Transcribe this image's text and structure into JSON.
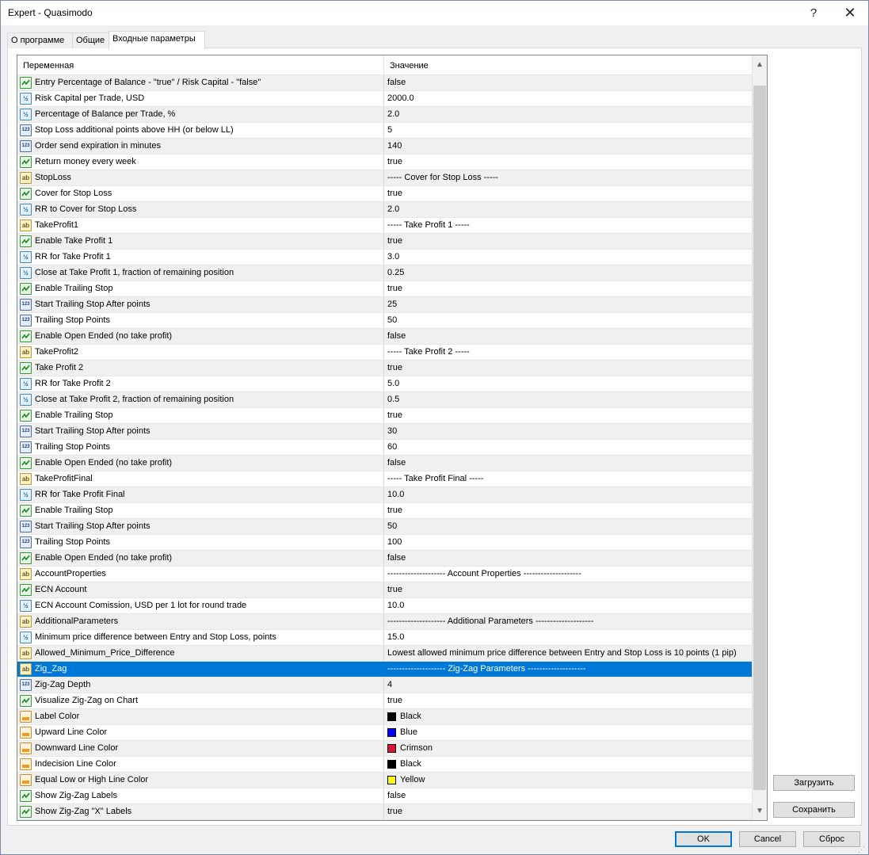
{
  "window": {
    "title": "Expert - Quasimodo",
    "help_label": "?",
    "close_label": "✕"
  },
  "tabs": [
    {
      "label": "О программе"
    },
    {
      "label": "Общие"
    },
    {
      "label": "Входные параметры"
    }
  ],
  "grid": {
    "col_variable": "Переменная",
    "col_value": "Значение",
    "rows": [
      {
        "icon": "bool",
        "name": "Entry Percentage of Balance - \"true\" / Risk Capital - \"false\"",
        "value": "false"
      },
      {
        "icon": "dbl",
        "name": "Risk Capital per Trade, USD",
        "value": "2000.0"
      },
      {
        "icon": "dbl",
        "name": "Percentage of Balance per Trade, %",
        "value": "2.0"
      },
      {
        "icon": "int",
        "name": "Stop Loss additional points above HH (or below LL)",
        "value": "5"
      },
      {
        "icon": "int",
        "name": "Order send expiration in minutes",
        "value": "140"
      },
      {
        "icon": "bool",
        "name": "Return money every week",
        "value": "true"
      },
      {
        "icon": "str",
        "name": "StopLoss",
        "value": "----- Cover for Stop Loss -----"
      },
      {
        "icon": "bool",
        "name": "Cover for Stop Loss",
        "value": "true"
      },
      {
        "icon": "dbl",
        "name": "RR to Cover for Stop Loss",
        "value": "2.0"
      },
      {
        "icon": "str",
        "name": "TakeProfit1",
        "value": "----- Take Profit 1 -----"
      },
      {
        "icon": "bool",
        "name": "Enable Take Profit 1",
        "value": "true"
      },
      {
        "icon": "dbl",
        "name": "RR for Take Profit 1",
        "value": "3.0"
      },
      {
        "icon": "dbl",
        "name": "Close at Take Profit 1, fraction of remaining position",
        "value": "0.25"
      },
      {
        "icon": "bool",
        "name": "Enable Trailing Stop",
        "value": "true"
      },
      {
        "icon": "int",
        "name": "Start Trailing Stop After points",
        "value": "25"
      },
      {
        "icon": "int",
        "name": "Trailing Stop Points",
        "value": "50"
      },
      {
        "icon": "bool",
        "name": "Enable Open Ended (no take profit)",
        "value": "false"
      },
      {
        "icon": "str",
        "name": "TakeProfit2",
        "value": "----- Take Profit 2 -----"
      },
      {
        "icon": "bool",
        "name": "Take Profit 2",
        "value": "true"
      },
      {
        "icon": "dbl",
        "name": "RR for Take Profit 2",
        "value": "5.0"
      },
      {
        "icon": "dbl",
        "name": "Close at Take Profit 2, fraction of remaining position",
        "value": "0.5"
      },
      {
        "icon": "bool",
        "name": "Enable Trailing Stop",
        "value": "true"
      },
      {
        "icon": "int",
        "name": "Start Trailing Stop After points",
        "value": "30"
      },
      {
        "icon": "int",
        "name": "Trailing Stop Points",
        "value": "60"
      },
      {
        "icon": "bool",
        "name": "Enable Open Ended (no take profit)",
        "value": "false"
      },
      {
        "icon": "str",
        "name": "TakeProfitFinal",
        "value": "----- Take Profit Final -----"
      },
      {
        "icon": "dbl",
        "name": "RR for Take Profit Final",
        "value": "10.0"
      },
      {
        "icon": "bool",
        "name": "Enable Trailing Stop",
        "value": "true"
      },
      {
        "icon": "int",
        "name": "Start Trailing Stop After points",
        "value": "50"
      },
      {
        "icon": "int",
        "name": "Trailing Stop Points",
        "value": "100"
      },
      {
        "icon": "bool",
        "name": "Enable Open Ended (no take profit)",
        "value": "false"
      },
      {
        "icon": "str",
        "name": "AccountProperties",
        "value": "-------------------- Account Properties --------------------"
      },
      {
        "icon": "bool",
        "name": "ECN Account",
        "value": "true"
      },
      {
        "icon": "dbl",
        "name": "ECN Account Comission, USD per 1 lot for round trade",
        "value": "10.0"
      },
      {
        "icon": "str",
        "name": "AdditionalParameters",
        "value": "-------------------- Additional Parameters --------------------"
      },
      {
        "icon": "dbl",
        "name": "Minimum price difference between Entry and Stop Loss, points",
        "value": "15.0"
      },
      {
        "icon": "str",
        "name": "Allowed_Minimum_Price_Difference",
        "value": "Lowest allowed minimum price difference between Entry and Stop Loss is 10 points (1 pip)"
      },
      {
        "icon": "str",
        "name": "Zig_Zag",
        "value": "-------------------- Zig-Zag Parameters --------------------",
        "selected": true
      },
      {
        "icon": "int",
        "name": "Zig-Zag Depth",
        "value": "4"
      },
      {
        "icon": "bool",
        "name": "Visualize Zig-Zag on Chart",
        "value": "true"
      },
      {
        "icon": "clr",
        "name": "Label Color",
        "value": "Black",
        "swatch": "#000000"
      },
      {
        "icon": "clr",
        "name": "Upward Line Color",
        "value": "Blue",
        "swatch": "#0000ff"
      },
      {
        "icon": "clr",
        "name": "Downward Line Color",
        "value": "Crimson",
        "swatch": "#dc143c"
      },
      {
        "icon": "clr",
        "name": "Indecision Line Color",
        "value": "Black",
        "swatch": "#000000"
      },
      {
        "icon": "clr",
        "name": "Equal Low or High Line Color",
        "value": "Yellow",
        "swatch": "#ffff00"
      },
      {
        "icon": "bool",
        "name": "Show Zig-Zag Labels",
        "value": "false"
      },
      {
        "icon": "bool",
        "name": "Show Zig-Zag \"X\" Labels",
        "value": "true"
      }
    ]
  },
  "buttons": {
    "load": "Загрузить",
    "save": "Сохранить",
    "ok": "OK",
    "cancel": "Cancel",
    "reset": "Сброс"
  },
  "icons": {
    "bool": "boolean-param-icon",
    "dbl": "double-param-icon",
    "int": "integer-param-icon",
    "str": "string-param-icon",
    "clr": "color-param-icon"
  },
  "colors": {
    "selection": "#0078d7",
    "row_alt": "#f0f0f0"
  }
}
